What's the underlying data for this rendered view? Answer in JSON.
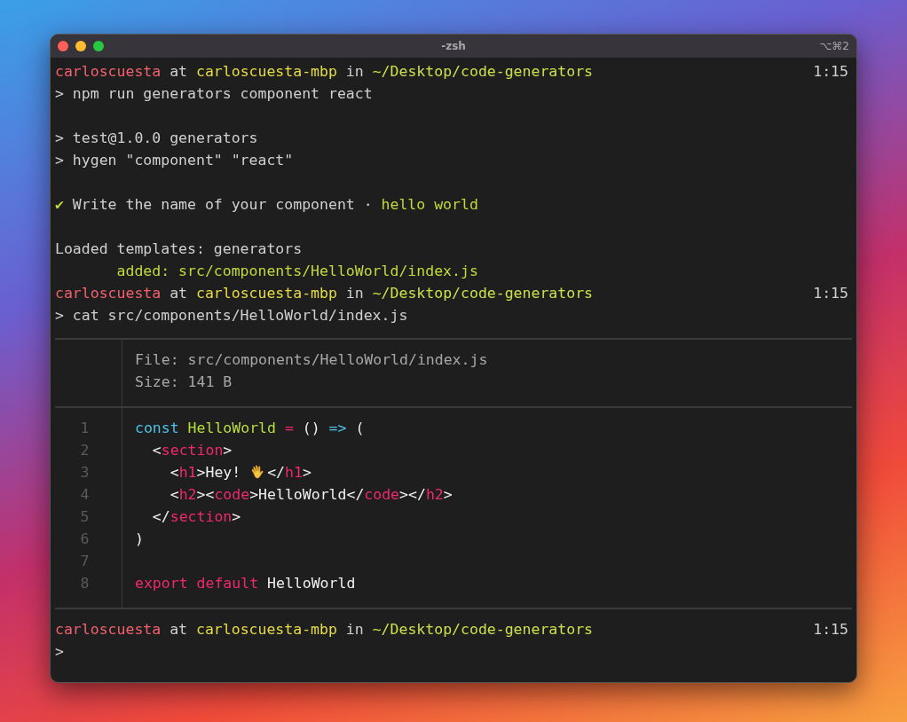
{
  "window": {
    "title": "-zsh",
    "shortcut": "⌥⌘2"
  },
  "terminal": [
    {
      "kind": "prompt",
      "tokens": [
        {
          "kind": "user",
          "text": "carloscuesta"
        },
        {
          "kind": "plain",
          "text": " at "
        },
        {
          "kind": "host",
          "text": "carloscuesta-mbp"
        },
        {
          "kind": "plain",
          "text": " in "
        },
        {
          "kind": "path",
          "text": "~/Desktop/code-generators"
        }
      ],
      "time": "1:15"
    },
    {
      "kind": "command",
      "tokens": [
        {
          "kind": "plain",
          "text": "> npm run generators component react"
        }
      ]
    },
    {
      "kind": "blank"
    },
    {
      "kind": "output",
      "tokens": [
        {
          "kind": "plain",
          "text": "> test@1.0.0 generators"
        }
      ]
    },
    {
      "kind": "output",
      "tokens": [
        {
          "kind": "plain",
          "text": "> hygen \"component\" \"react\""
        }
      ]
    },
    {
      "kind": "blank"
    },
    {
      "kind": "output",
      "tokens": [
        {
          "kind": "success",
          "text": "✔"
        },
        {
          "kind": "plain",
          "text": " Write the name of your component · "
        },
        {
          "kind": "success",
          "text": "hello world"
        }
      ]
    },
    {
      "kind": "blank"
    },
    {
      "kind": "output",
      "tokens": [
        {
          "kind": "plain",
          "text": "Loaded templates: generators"
        }
      ]
    },
    {
      "kind": "output",
      "tokens": [
        {
          "kind": "success",
          "text": "       added: src/components/HelloWorld/index.js"
        }
      ]
    },
    {
      "kind": "prompt",
      "tokens": [
        {
          "kind": "user",
          "text": "carloscuesta"
        },
        {
          "kind": "plain",
          "text": " at "
        },
        {
          "kind": "host",
          "text": "carloscuesta-mbp"
        },
        {
          "kind": "plain",
          "text": " in "
        },
        {
          "kind": "path",
          "text": "~/Desktop/code-generators"
        }
      ],
      "time": "1:15"
    },
    {
      "kind": "command",
      "tokens": [
        {
          "kind": "plain",
          "text": "> cat src/components/HelloWorld/index.js"
        }
      ]
    },
    {
      "kind": "file",
      "header": [
        [
          {
            "kind": "muted",
            "text": "File: src/components/HelloWorld/index.js"
          }
        ],
        [
          {
            "kind": "muted",
            "text": "Size: 141 B"
          }
        ]
      ],
      "code": [
        {
          "number": "1",
          "tokens": [
            {
              "kind": "keyword",
              "text": "const"
            },
            {
              "kind": "function",
              "text": " HelloWorld"
            },
            {
              "kind": "tag",
              "text": " ="
            },
            {
              "kind": "bright",
              "text": " () "
            },
            {
              "kind": "keyword",
              "text": "=>"
            },
            {
              "kind": "bright",
              "text": " ("
            }
          ]
        },
        {
          "number": "2",
          "tokens": [
            {
              "kind": "bright",
              "text": "  <"
            },
            {
              "kind": "tag",
              "text": "section"
            },
            {
              "kind": "bright",
              "text": ">"
            }
          ]
        },
        {
          "number": "3",
          "tokens": [
            {
              "kind": "bright",
              "text": "    <"
            },
            {
              "kind": "tag",
              "text": "h1"
            },
            {
              "kind": "bright",
              "text": ">Hey! "
            },
            {
              "kind": "hand_icon"
            },
            {
              "kind": "bright",
              "text": "</"
            },
            {
              "kind": "tag",
              "text": "h1"
            },
            {
              "kind": "bright",
              "text": ">"
            }
          ]
        },
        {
          "number": "4",
          "tokens": [
            {
              "kind": "bright",
              "text": "    <"
            },
            {
              "kind": "tag",
              "text": "h2"
            },
            {
              "kind": "bright",
              "text": "><"
            },
            {
              "kind": "tag",
              "text": "code"
            },
            {
              "kind": "bright",
              "text": ">HelloWorld</"
            },
            {
              "kind": "tag",
              "text": "code"
            },
            {
              "kind": "bright",
              "text": "></"
            },
            {
              "kind": "tag",
              "text": "h2"
            },
            {
              "kind": "bright",
              "text": ">"
            }
          ]
        },
        {
          "number": "5",
          "tokens": [
            {
              "kind": "bright",
              "text": "  </"
            },
            {
              "kind": "tag",
              "text": "section"
            },
            {
              "kind": "bright",
              "text": ">"
            }
          ]
        },
        {
          "number": "6",
          "tokens": [
            {
              "kind": "bright",
              "text": ")"
            }
          ]
        },
        {
          "number": "7"
        },
        {
          "number": "8",
          "tokens": [
            {
              "kind": "tag",
              "text": "export default"
            },
            {
              "kind": "bright",
              "text": " HelloWorld"
            }
          ]
        }
      ]
    },
    {
      "kind": "prompt",
      "tokens": [
        {
          "kind": "user",
          "text": "carloscuesta"
        },
        {
          "kind": "plain",
          "text": " at "
        },
        {
          "kind": "host",
          "text": "carloscuesta-mbp"
        },
        {
          "kind": "plain",
          "text": " in "
        },
        {
          "kind": "path",
          "text": "~/Desktop/code-generators"
        }
      ],
      "time": "1:15"
    },
    {
      "kind": "command",
      "tokens": [
        {
          "kind": "plain",
          "text": ">"
        }
      ]
    }
  ]
}
